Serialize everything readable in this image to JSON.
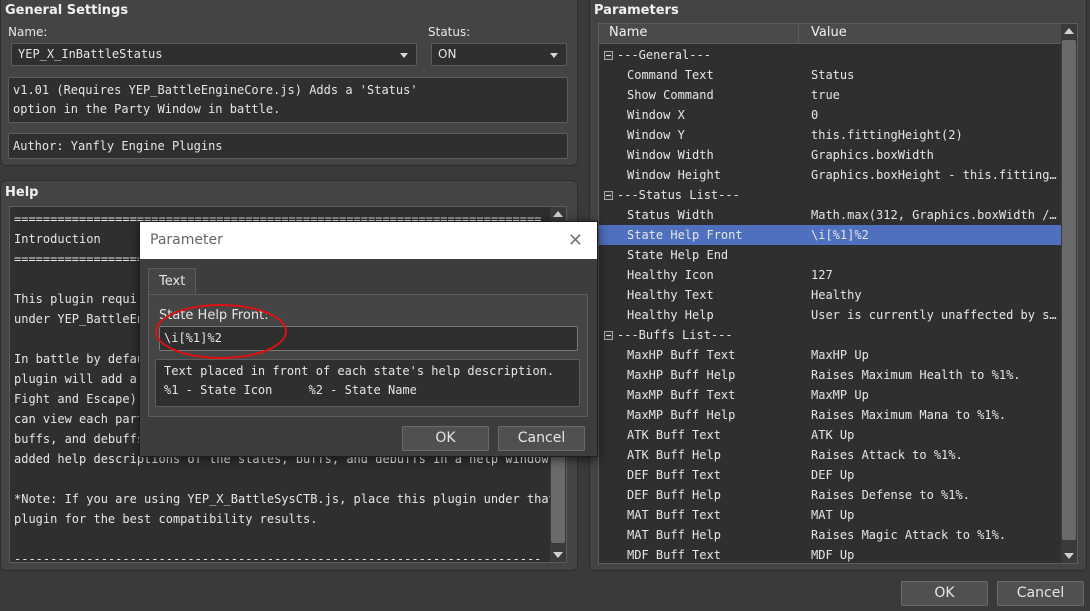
{
  "general": {
    "title": "General Settings",
    "name_label": "Name:",
    "name_value": "YEP_X_InBattleStatus",
    "status_label": "Status:",
    "status_value": "ON",
    "description": "v1.01 (Requires YEP_BattleEngineCore.js) Adds a 'Status'\noption in the Party Window in battle.",
    "author": "Author: Yanfly Engine Plugins"
  },
  "help": {
    "title": "Help",
    "text": "=========================================================================\nIntroduction\n=========================================================================\n\nThis plugin requires YEP_BattleEngineCore.js. Place this plugin\nunder YEP_BattleEngineCore.js in the Plugin Manager list.\n\nIn battle by default, the Party Window has 'Fight' and 'Escape'. This\nplugin will add a new 'Status' command to the Party Window (after\nFight and Escape) that allows the player to view each party member's\ncan view each party member's status and have a look at their states,\nbuffs, and debuffs. With this plugin, the player will also be able to view\nadded help descriptions of the states, buffs, and debuffs in a help window.\n\n*Note: If you are using YEP_X_BattleSysCTB.js, place this plugin under that\nplugin for the best compatibility results.\n\n-------------------------------------------------------------------------"
  },
  "parameters": {
    "title": "Parameters",
    "col_name": "Name",
    "col_value": "Value",
    "rows": [
      {
        "name": "---General---",
        "value": "",
        "group": true
      },
      {
        "name": "Command Text",
        "value": "Status"
      },
      {
        "name": "Show Command",
        "value": "true"
      },
      {
        "name": "Window X",
        "value": "0"
      },
      {
        "name": "Window Y",
        "value": "this.fittingHeight(2)"
      },
      {
        "name": "Window Width",
        "value": "Graphics.boxWidth"
      },
      {
        "name": "Window Height",
        "value": "Graphics.boxHeight - this.fittingH…"
      },
      {
        "name": "---Status List---",
        "value": "",
        "group": true
      },
      {
        "name": "Status Width",
        "value": "Math.max(312, Graphics.boxWidth / …"
      },
      {
        "name": "State Help Front",
        "value": "\\i[%1]%2",
        "selected": true
      },
      {
        "name": "State Help End",
        "value": ""
      },
      {
        "name": "Healthy Icon",
        "value": "127"
      },
      {
        "name": "Healthy Text",
        "value": "Healthy"
      },
      {
        "name": "Healthy Help",
        "value": "User is currently unaffected by st…"
      },
      {
        "name": "---Buffs List---",
        "value": "",
        "group": true
      },
      {
        "name": "MaxHP Buff Text",
        "value": "MaxHP Up"
      },
      {
        "name": "MaxHP Buff Help",
        "value": "Raises Maximum Health to %1%."
      },
      {
        "name": "MaxMP Buff Text",
        "value": "MaxMP Up"
      },
      {
        "name": "MaxMP Buff Help",
        "value": "Raises Maximum Mana to %1%."
      },
      {
        "name": "ATK Buff Text",
        "value": "ATK Up"
      },
      {
        "name": "ATK Buff Help",
        "value": "Raises Attack to %1%."
      },
      {
        "name": "DEF Buff Text",
        "value": "DEF Up"
      },
      {
        "name": "DEF Buff Help",
        "value": "Raises Defense to %1%."
      },
      {
        "name": "MAT Buff Text",
        "value": "MAT Up"
      },
      {
        "name": "MAT Buff Help",
        "value": "Raises Magic Attack to %1%."
      },
      {
        "name": "MDF Buff Text",
        "value": "MDF Up"
      }
    ]
  },
  "footer": {
    "ok_label": "OK",
    "cancel_label": "Cancel"
  },
  "dialog": {
    "title": "Parameter",
    "close_glyph": "✕",
    "tab_label": "Text",
    "field_label": "State Help Front:",
    "field_value": "\\i[%1]%2",
    "description": "Text placed in front of each state's help description.\n%1 - State Icon     %2 - State Name",
    "ok_label": "OK",
    "cancel_label": "Cancel"
  },
  "colors": {
    "selection": "#4f6fbf",
    "annotation": "#e01010"
  }
}
